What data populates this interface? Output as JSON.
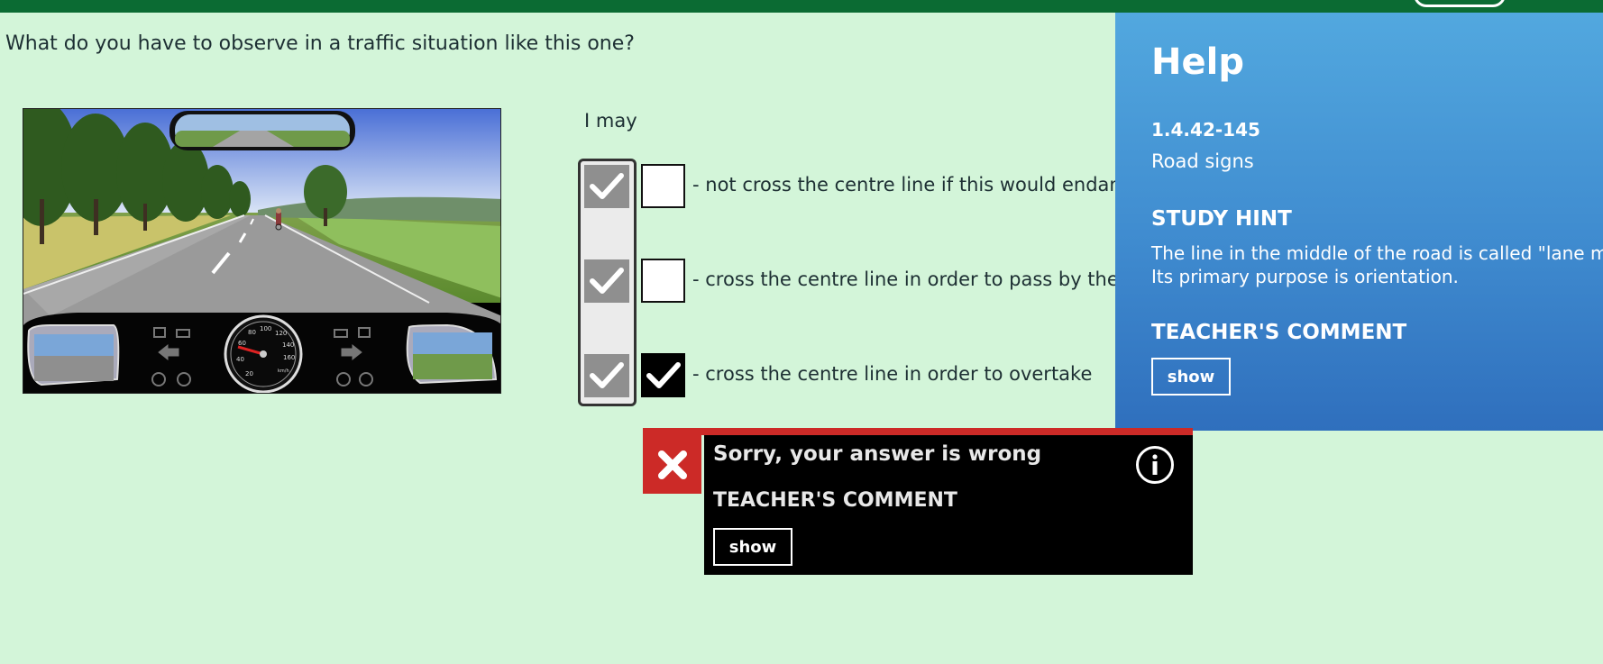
{
  "question": "What do you have to observe in a traffic situation like this one?",
  "lead_text": "I may",
  "answers": [
    {
      "text": "- not cross the centre line if this would endanger",
      "correct": true,
      "selected": false
    },
    {
      "text": "- cross the centre line in order to pass by the o",
      "correct": true,
      "selected": false
    },
    {
      "text": "- cross the centre line in order to overtake",
      "correct": true,
      "selected": true
    }
  ],
  "help": {
    "title": "Help",
    "code": "1.4.42-145",
    "category": "Road signs",
    "study_hint_heading": "STUDY HINT",
    "study_hint_line1": "The line in the middle of the road is called \"lane ma",
    "study_hint_line2": "Its primary purpose is orientation.",
    "teacher_comment_heading": "TEACHER'S COMMENT",
    "show_label": "show"
  },
  "result": {
    "message": "Sorry, your answer is wrong",
    "teacher_comment_heading": "TEACHER'S COMMENT",
    "show_label": "show"
  },
  "icons": {
    "wrong": "close-x-icon",
    "info": "info-icon",
    "check": "checkmark-icon"
  },
  "colors": {
    "background": "#d3f5d9",
    "topbar": "#0b6b33",
    "help_panel": "#3f8bcf",
    "error_red": "#cc2a27"
  },
  "speedometer_ticks": [
    "20",
    "40",
    "60",
    "80",
    "100",
    "120",
    "140",
    "160"
  ],
  "speed_unit": "km/h"
}
